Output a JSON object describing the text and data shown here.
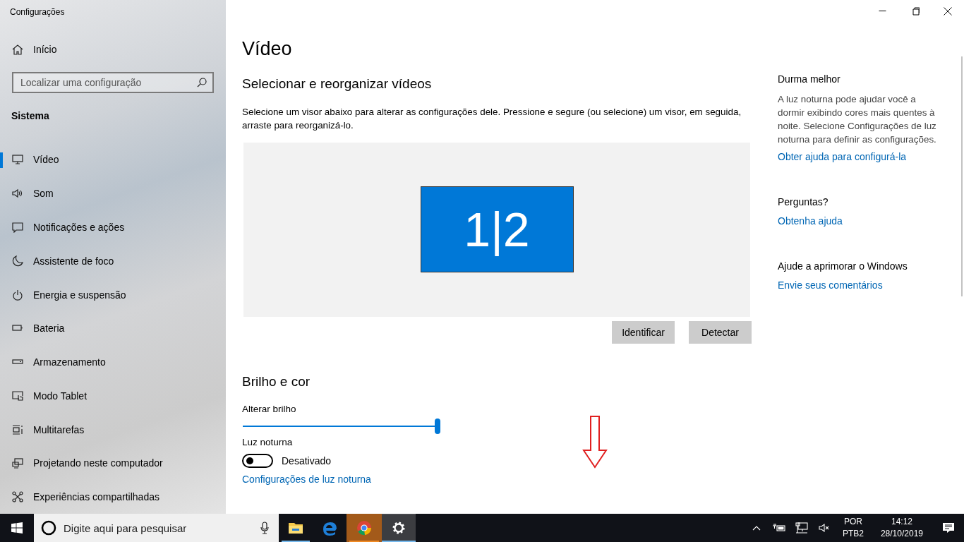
{
  "window": {
    "title": "Configurações"
  },
  "sidebar": {
    "home": "Início",
    "search": {
      "placeholder": "Localizar uma configuração"
    },
    "section": "Sistema",
    "items": [
      {
        "label": "Vídeo",
        "selected": true
      },
      {
        "label": "Som",
        "selected": false
      },
      {
        "label": "Notificações e ações",
        "selected": false
      },
      {
        "label": "Assistente de foco",
        "selected": false
      },
      {
        "label": "Energia e suspensão",
        "selected": false
      },
      {
        "label": "Bateria",
        "selected": false
      },
      {
        "label": "Armazenamento",
        "selected": false
      },
      {
        "label": "Modo Tablet",
        "selected": false
      },
      {
        "label": "Multitarefas",
        "selected": false
      },
      {
        "label": "Projetando neste computador",
        "selected": false
      },
      {
        "label": "Experiências compartilhadas",
        "selected": false
      }
    ]
  },
  "page": {
    "title": "Vídeo",
    "arrange": {
      "heading": "Selecionar e reorganizar vídeos",
      "description": "Selecione um visor abaixo para alterar as configurações dele. Pressione e segure (ou selecione) um visor, em seguida, arraste para reorganizá-lo.",
      "monitor_label": "1|2",
      "buttons": [
        "Identificar",
        "Detectar"
      ]
    },
    "brightness": {
      "heading": "Brilho e cor",
      "slider_label": "Alterar brilho",
      "level": 1,
      "night_light": {
        "label": "Luz noturna",
        "on": false,
        "state_text": "Desativado"
      },
      "link": "Configurações de luz noturna"
    }
  },
  "related": [
    {
      "heading": "Durma melhor",
      "text": "A luz noturna pode ajudar você a dormir exibindo cores mais quentes à noite. Selecione Configurações de luz noturna para definir as configurações.",
      "link": "Obter ajuda para configurá-la"
    },
    {
      "heading": "Perguntas?",
      "link": "Obtenha ajuda"
    },
    {
      "heading": "Ajude a aprimorar o Windows",
      "link": "Envie seus comentários"
    }
  ],
  "taskbar": {
    "search": {
      "placeholder": "Digite aqui para pesquisar"
    },
    "apps": [
      {
        "running": true,
        "selected": false,
        "flashing": false
      },
      {
        "running": false,
        "selected": false,
        "flashing": false
      },
      {
        "running": true,
        "selected": false,
        "flashing": true
      },
      {
        "running": true,
        "selected": true,
        "flashing": false
      }
    ],
    "language": [
      "POR",
      "PTB2"
    ],
    "time": "14:12",
    "date": "28/10/2019"
  }
}
